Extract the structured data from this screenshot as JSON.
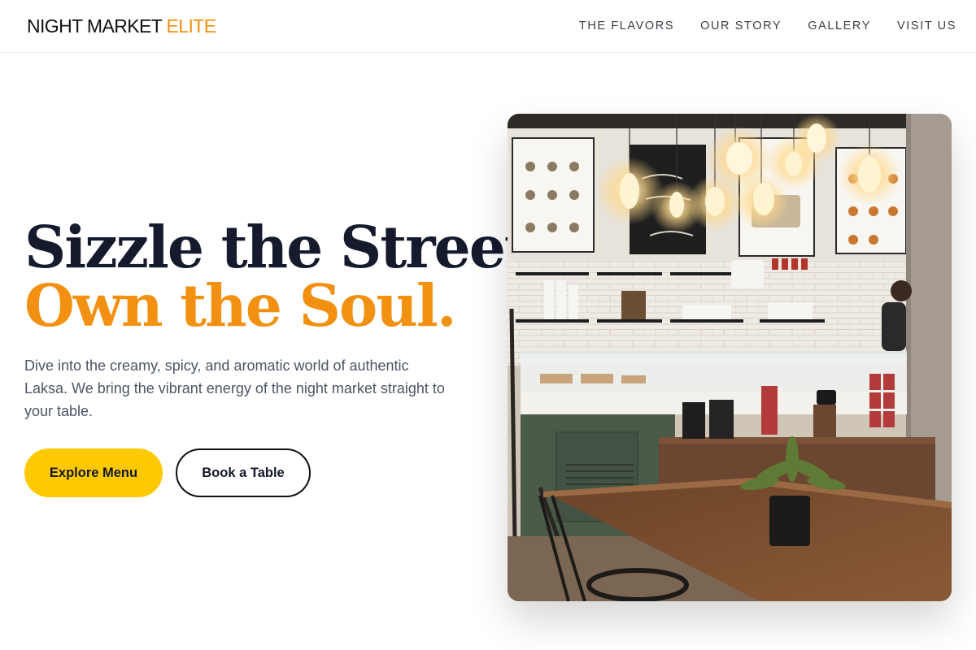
{
  "brand": {
    "name_main": "NIGHT MARKET ",
    "name_accent": "ELITE",
    "accent_color": "#f29111"
  },
  "nav": {
    "items": [
      {
        "label": "THE FLAVORS"
      },
      {
        "label": "OUR STORY"
      },
      {
        "label": "GALLERY"
      },
      {
        "label": "VISIT US"
      }
    ]
  },
  "hero": {
    "headline_line1": "Sizzle the Street,",
    "headline_line2": "Own the Soul.",
    "description": "Dive into the creamy, spicy, and aromatic world of authentic Laksa. We bring the vibrant energy of the night market straight to your table.",
    "primary_button": "Explore Menu",
    "secondary_button": "Book a Table",
    "primary_color": "#ffc900",
    "image_icon": "cafe-interior-photo"
  }
}
